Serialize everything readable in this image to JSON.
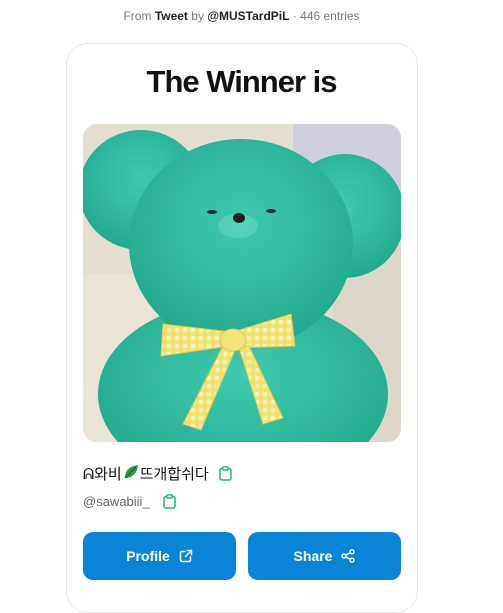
{
  "source": {
    "from_label": "From",
    "platform": "Tweet",
    "by_label": "by",
    "author": "@MUSTardPiL",
    "separator": "·",
    "entries": "446 entries"
  },
  "result": {
    "title": "The Winner is",
    "winner_name_prefix": "ᕱ와비",
    "winner_name_suffix": "뜨개합쉬다",
    "winner_handle": "@sawabiii_",
    "image_subject": "teal plush teddy bear with yellow gingham ribbon"
  },
  "actions": {
    "profile_label": "Profile",
    "share_label": "Share"
  },
  "icons": {
    "name_emoji": "leaf-icon",
    "copy": "clipboard-icon",
    "profile": "external-link-icon",
    "share": "share-icon"
  },
  "colors": {
    "button_bg": "#0a84d6",
    "copy_icon": "#22b573",
    "bear": "#2fbea0",
    "ribbon": "#f2e27a"
  }
}
